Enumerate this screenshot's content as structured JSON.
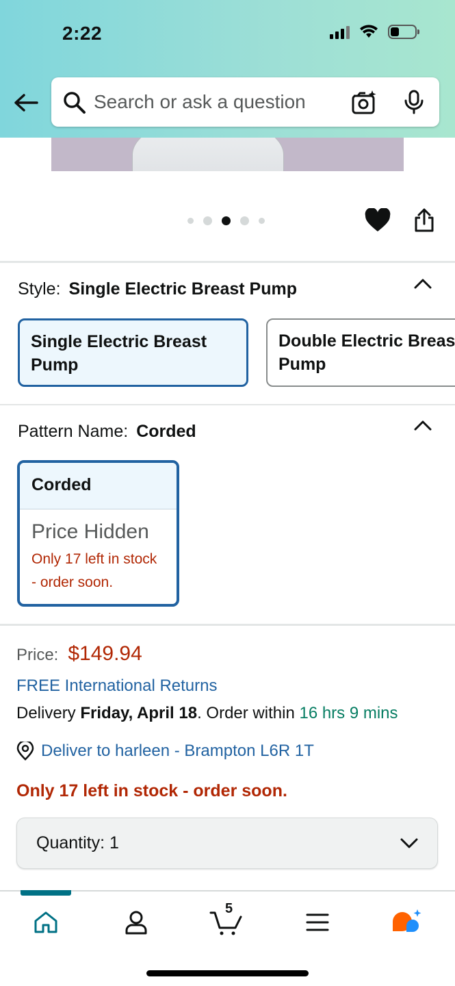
{
  "status_bar": {
    "time": "2:22"
  },
  "search": {
    "placeholder": "Search or ask a question"
  },
  "carousel": {
    "total": 5,
    "active_index": 2
  },
  "style_section": {
    "label": "Style:",
    "value": "Single Electric Breast Pump",
    "options": [
      {
        "label": "Single Electric Breast Pump",
        "selected": true
      },
      {
        "label": "Double Electric Breast Pump",
        "selected": false
      }
    ]
  },
  "pattern_section": {
    "label": "Pattern Name:",
    "value": "Corded",
    "card": {
      "title": "Corded",
      "price": "Price Hidden",
      "stock": "Only 17 left in stock - order soon."
    }
  },
  "buybox": {
    "price_label": "Price:",
    "price_value": "$149.94",
    "returns_link": "FREE International Returns",
    "delivery_prefix": "Delivery",
    "delivery_date": "Friday, April 18",
    "delivery_mid": ". Order within",
    "delivery_countdown": "16 hrs 9 mins",
    "deliver_to": "Deliver to harleen - Brampton L6R 1T",
    "stock_warning": "Only 17 left in stock - order soon.",
    "quantity_label": "Quantity:",
    "quantity_value": "1"
  },
  "tabbar": {
    "tabs": [
      {
        "name": "home",
        "active": true
      },
      {
        "name": "account"
      },
      {
        "name": "cart",
        "count": "5"
      },
      {
        "name": "menu"
      },
      {
        "name": "rufus"
      }
    ]
  },
  "colors": {
    "link": "#2162a1",
    "price": "#b12704",
    "countdown": "#067d62",
    "selected_border": "#2162a1",
    "active_tab": "#007185",
    "rufus_orange": "#ff6200",
    "rufus_blue": "#1f8ffb"
  }
}
